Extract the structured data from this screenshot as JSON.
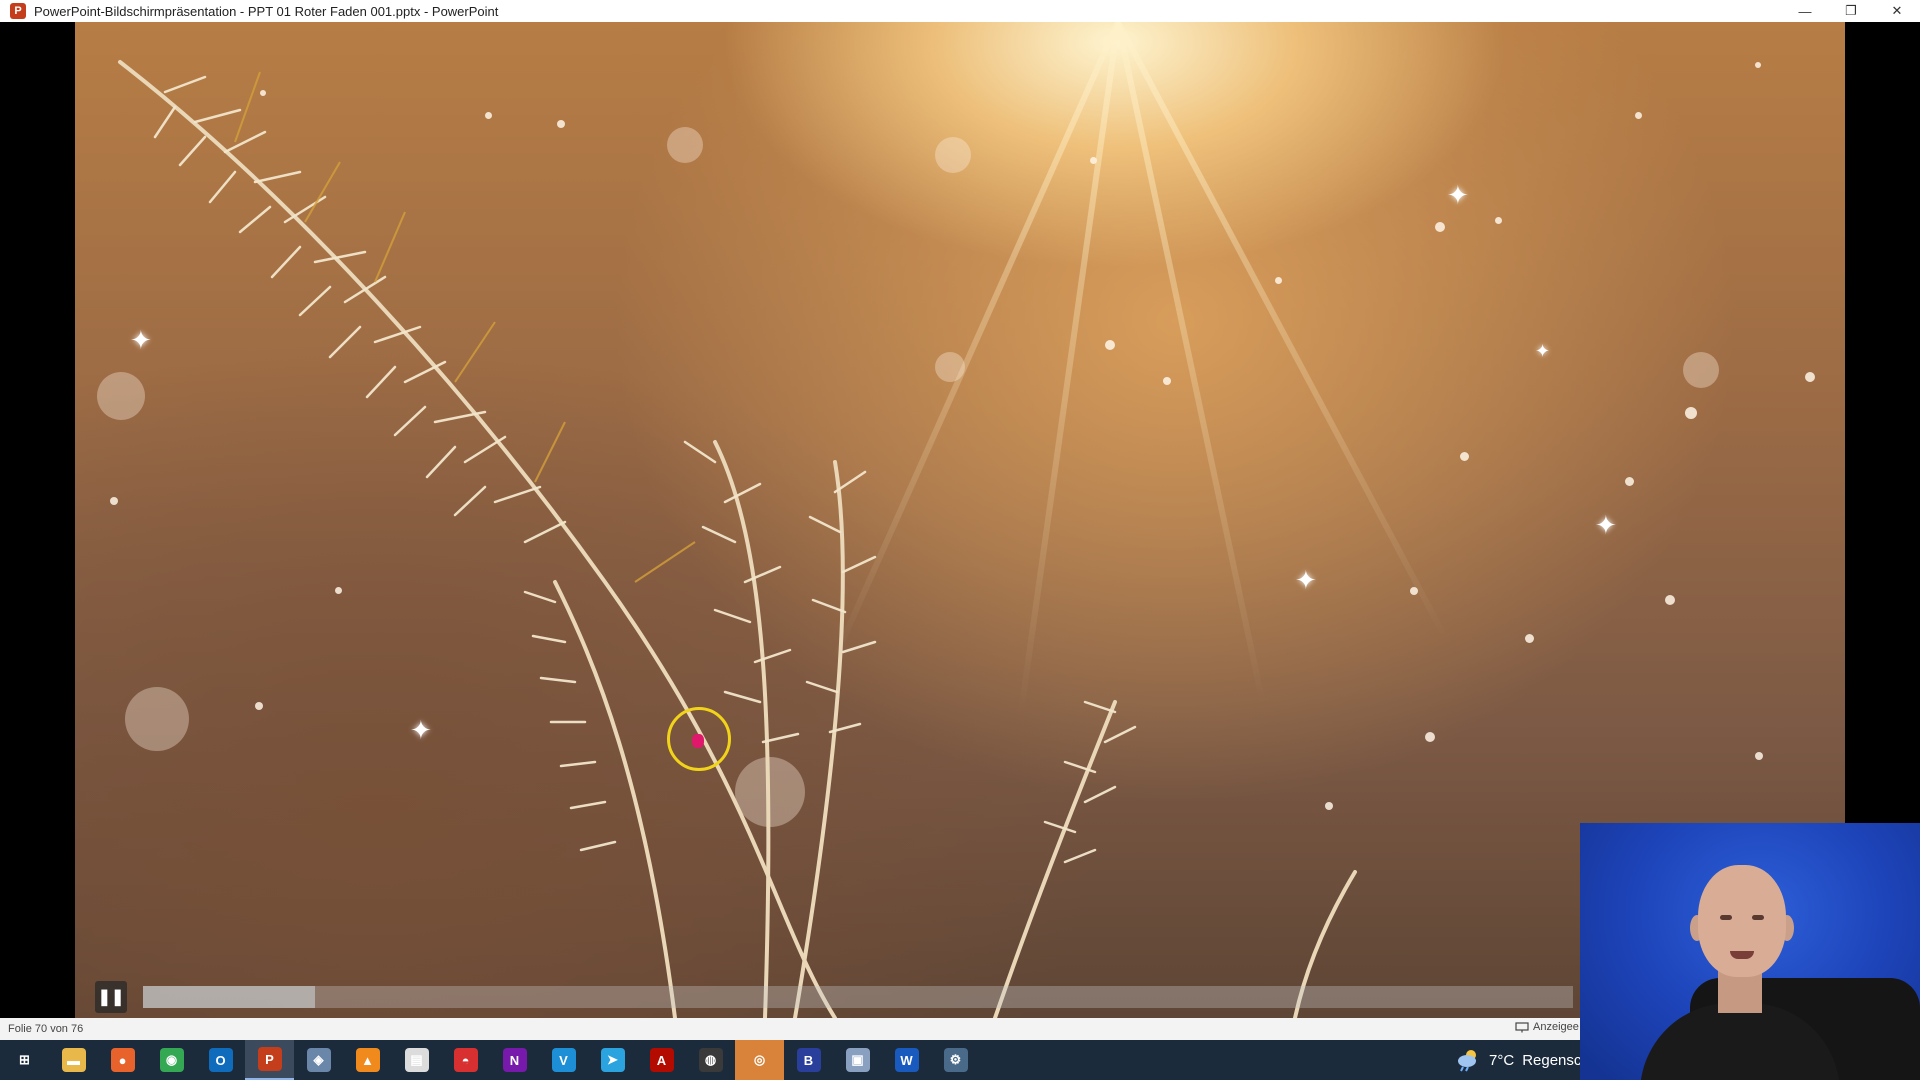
{
  "window": {
    "app_icon": "P",
    "title": "PowerPoint-Bildschirmpräsentation  -  PPT 01 Roter Faden 001.pptx - PowerPoint",
    "controls": {
      "minimize": "—",
      "restore": "❐",
      "close": "✕"
    }
  },
  "media": {
    "pause_icon": "❚❚",
    "progress": 0.12
  },
  "status": {
    "slide_counter": "Folie 70 von 76",
    "view_label": "Anzeigee",
    "view_icon": "presenter-view-icon"
  },
  "taskbar": {
    "items": [
      {
        "name": "start",
        "glyph": "⊞",
        "color": "#1c2b3c"
      },
      {
        "name": "file-explorer",
        "glyph": "▬",
        "color": "#e8b84a"
      },
      {
        "name": "firefox",
        "glyph": "●",
        "color": "#e8632c"
      },
      {
        "name": "chrome",
        "glyph": "◉",
        "color": "#34a853"
      },
      {
        "name": "outlook",
        "glyph": "O",
        "color": "#0f6cbd"
      },
      {
        "name": "powerpoint",
        "glyph": "P",
        "color": "#c43e1c"
      },
      {
        "name": "app-cursor",
        "glyph": "◈",
        "color": "#6a86a8"
      },
      {
        "name": "vlc",
        "glyph": "▲",
        "color": "#f08a1c"
      },
      {
        "name": "notepad",
        "glyph": "▤",
        "color": "#dcdcdc"
      },
      {
        "name": "lips-app",
        "glyph": "◓",
        "color": "#d83030"
      },
      {
        "name": "onenote",
        "glyph": "N",
        "color": "#7719aa"
      },
      {
        "name": "vectorworks",
        "glyph": "V",
        "color": "#1c8fd6"
      },
      {
        "name": "telegram",
        "glyph": "➤",
        "color": "#2aa3df"
      },
      {
        "name": "acrobat",
        "glyph": "A",
        "color": "#b30b00"
      },
      {
        "name": "obs",
        "glyph": "◍",
        "color": "#3a3a3a"
      },
      {
        "name": "recorder",
        "glyph": "◎",
        "color": "#d9833a"
      },
      {
        "name": "blue-app",
        "glyph": "B",
        "color": "#2a3e9c"
      },
      {
        "name": "remote-app",
        "glyph": "▣",
        "color": "#8aa0c0"
      },
      {
        "name": "word",
        "glyph": "W",
        "color": "#185abd"
      },
      {
        "name": "network-app",
        "glyph": "⚙",
        "color": "#4a6a8a"
      }
    ],
    "active_index": 5,
    "highlight_index": 15,
    "weather": {
      "icon": "weather-cloud-rain-icon",
      "temperature": "7°C",
      "description": "Regensch"
    }
  }
}
